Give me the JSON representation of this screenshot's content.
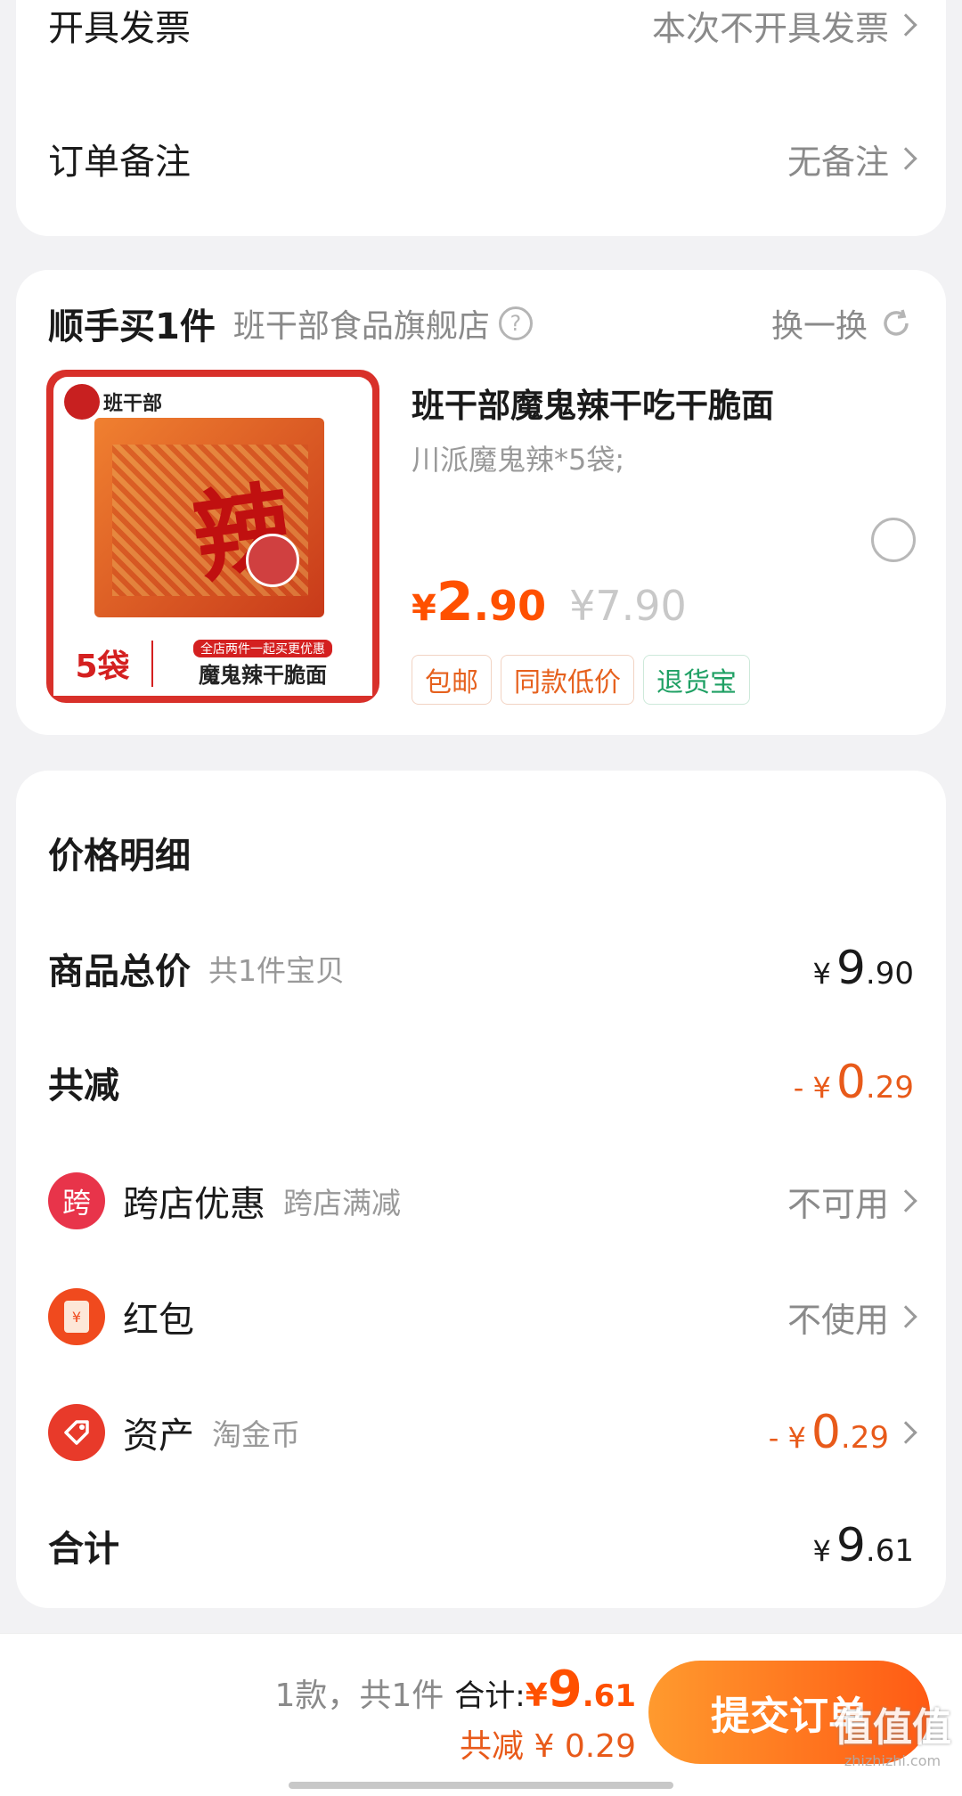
{
  "invoice": {
    "label": "开具发票",
    "value": "本次不开具发票"
  },
  "note": {
    "label": "订单备注",
    "value": "无备注"
  },
  "addon": {
    "title": "顺手买1件",
    "store": "班干部食品旗舰店",
    "swap_label": "换一换",
    "product": {
      "name": "班干部魔鬼辣干吃干脆面",
      "spec": "川派魔鬼辣*5袋;",
      "price_symbol": "¥",
      "price_int": "2",
      "price_dec": ".90",
      "original_price": "¥7.90",
      "tags": [
        "包邮",
        "同款低价",
        "退货宝"
      ],
      "image": {
        "brand": "班干部",
        "big_char": "辣",
        "count": "5袋",
        "banner": "全店两件一起买更优惠",
        "caption": "魔鬼辣干脆面"
      }
    }
  },
  "price_detail": {
    "title": "价格明细",
    "goods_total": {
      "label": "商品总价",
      "sub": "共1件宝贝",
      "symbol": "¥",
      "int": "9",
      "dec": ".90"
    },
    "discount": {
      "label": "共减",
      "prefix": "- ¥",
      "int": "0",
      "dec": ".29"
    },
    "cross_store": {
      "icon_char": "跨",
      "label": "跨店优惠",
      "sub": "跨店满减",
      "value": "不可用"
    },
    "red_packet": {
      "icon_char": "¥",
      "label": "红包",
      "value": "不使用"
    },
    "assets": {
      "label": "资产",
      "sub": "淘金币",
      "prefix": "- ¥",
      "int": "0",
      "dec": ".29"
    },
    "total": {
      "label": "合计",
      "symbol": "¥",
      "int": "9",
      "dec": ".61"
    }
  },
  "footer": {
    "count_text": "1款，共1件",
    "total_label": "合计:",
    "total_symbol": "¥",
    "total_int": "9",
    "total_dec": ".61",
    "saved_text": "共减 ¥ 0.29",
    "submit_label": "提交订单",
    "watermark": "值值值",
    "watermark_url": "zhizhizhi.com"
  },
  "colors": {
    "accent": "#ff5000",
    "submit_gradient_start": "#ff9a2e",
    "submit_gradient_end": "#ff5a14",
    "green_tag": "#1fa064"
  }
}
